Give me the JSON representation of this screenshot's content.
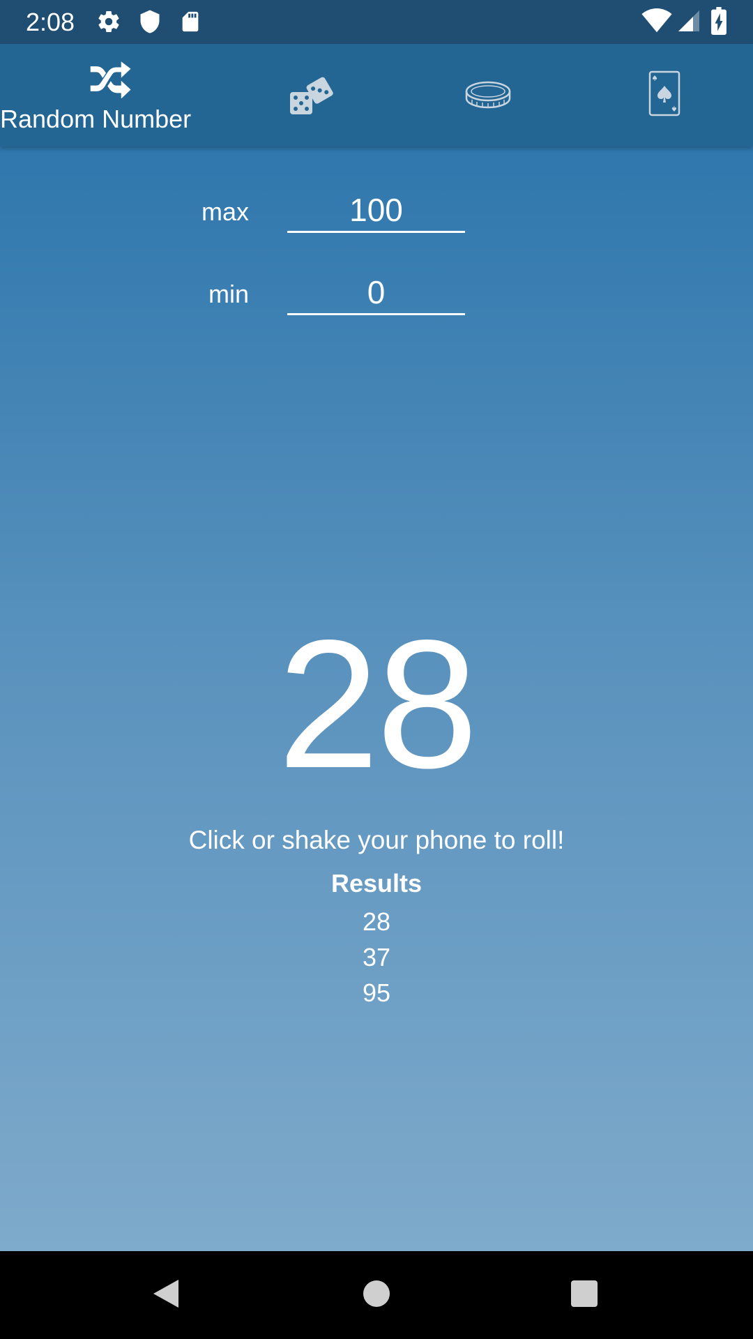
{
  "status_bar": {
    "time": "2:08",
    "left_icons": [
      "gear-icon",
      "shield-icon",
      "sd-card-icon"
    ],
    "right_icons": [
      "wifi-icon",
      "signal-icon",
      "battery-charging-icon"
    ]
  },
  "app_bar": {
    "tabs": [
      {
        "id": "random-number",
        "label": "Random Number",
        "icon": "shuffle-icon",
        "selected": true
      },
      {
        "id": "dice",
        "label": "",
        "icon": "dice-icon",
        "selected": false
      },
      {
        "id": "coin",
        "label": "",
        "icon": "coin-icon",
        "selected": false
      },
      {
        "id": "card",
        "label": "",
        "icon": "playing-card-icon",
        "selected": false
      }
    ]
  },
  "form": {
    "max_label": "max",
    "max_value": "100",
    "min_label": "min",
    "min_value": "0"
  },
  "roll": {
    "current": "28",
    "hint": "Click or shake your phone to roll!"
  },
  "results": {
    "title": "Results",
    "items": [
      "28",
      "37",
      "95"
    ]
  },
  "nav_bar": {
    "buttons": [
      "back-icon",
      "home-icon",
      "recents-icon"
    ]
  },
  "colors": {
    "status_bar": "#1f4e72",
    "app_bar": "#236593",
    "gradient_top": "#2f77ad",
    "gradient_bottom": "#7eaacb",
    "icon_inactive": "#c9d6e0"
  }
}
